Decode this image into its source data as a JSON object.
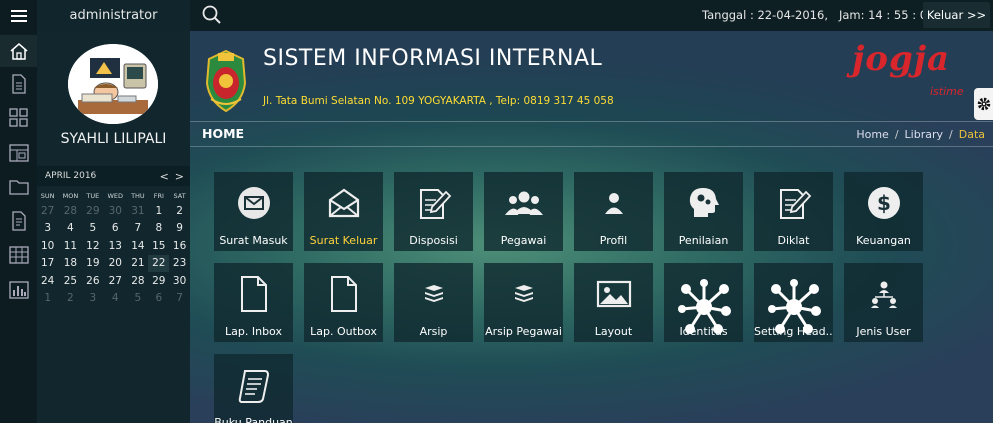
{
  "topbar": {
    "username": "administrator",
    "datetime": "Tanggal : 22-04-2016,   Jam: 14 : 55 : 01",
    "logout_label": "Keluar >>"
  },
  "sidebar": {
    "full_name": "SYAHLI LILIPALI",
    "rail_icons": [
      "menu-icon",
      "home-icon",
      "document-icon",
      "grid-icon",
      "layout-icon",
      "folder-icon",
      "file-text-icon",
      "table-icon",
      "bar-chart-icon"
    ]
  },
  "calendar": {
    "month_label": "APRIL 2016",
    "prev": "<",
    "next": ">",
    "weekdays": [
      "SUN",
      "MON",
      "TUE",
      "WED",
      "THU",
      "FRI",
      "SAT"
    ],
    "weeks": [
      [
        "27",
        "28",
        "29",
        "30",
        "31",
        "1",
        "2"
      ],
      [
        "3",
        "4",
        "5",
        "6",
        "7",
        "8",
        "9"
      ],
      [
        "10",
        "11",
        "12",
        "13",
        "14",
        "15",
        "16"
      ],
      [
        "17",
        "18",
        "19",
        "20",
        "21",
        "22",
        "23"
      ],
      [
        "24",
        "25",
        "26",
        "27",
        "28",
        "29",
        "30"
      ],
      [
        "1",
        "2",
        "3",
        "4",
        "5",
        "6",
        "7"
      ]
    ]
  },
  "banner": {
    "title": "SISTEM INFORMASI INTERNAL",
    "address": "Jl. Tata Bumi Selatan No. 109 YOGYAKARTA , Telp: 0819 317 45 058",
    "logo_word": "jogja",
    "logo_sub": "istime"
  },
  "breadcrumb": {
    "page_title": "HOME",
    "items": [
      "Home",
      "Library",
      "Data"
    ]
  },
  "tiles": [
    {
      "label": "Surat Masuk",
      "icon": "envelope-circle-icon",
      "highlight": false
    },
    {
      "label": "Surat Keluar",
      "icon": "envelope-open-icon",
      "highlight": true
    },
    {
      "label": "Disposisi",
      "icon": "edit-document-icon",
      "highlight": false
    },
    {
      "label": "Pegawai",
      "icon": "users-icon",
      "highlight": false
    },
    {
      "label": "Profil",
      "icon": "user-icon",
      "highlight": false
    },
    {
      "label": "Penilaian",
      "icon": "head-gears-icon",
      "highlight": false
    },
    {
      "label": "Diklat",
      "icon": "edit-document-icon",
      "highlight": false
    },
    {
      "label": "Keuangan",
      "icon": "dollar-circle-icon",
      "highlight": false
    },
    {
      "label": "Lap. Inbox",
      "icon": "file-icon",
      "highlight": false
    },
    {
      "label": "Lap. Outbox",
      "icon": "file-icon",
      "highlight": false
    },
    {
      "label": "Arsip",
      "icon": "stack-icon",
      "highlight": false
    },
    {
      "label": "Arsip Pegawai",
      "icon": "stack-icon",
      "highlight": false
    },
    {
      "label": "Layout",
      "icon": "image-icon",
      "highlight": false
    },
    {
      "label": "Identitas",
      "icon": "network-icon",
      "highlight": false
    },
    {
      "label": "Setting Head...",
      "icon": "network-icon",
      "highlight": false
    },
    {
      "label": "Jenis User",
      "icon": "org-chart-icon",
      "highlight": false
    },
    {
      "label": "Buku Panduan",
      "icon": "scroll-icon",
      "highlight": false
    }
  ]
}
